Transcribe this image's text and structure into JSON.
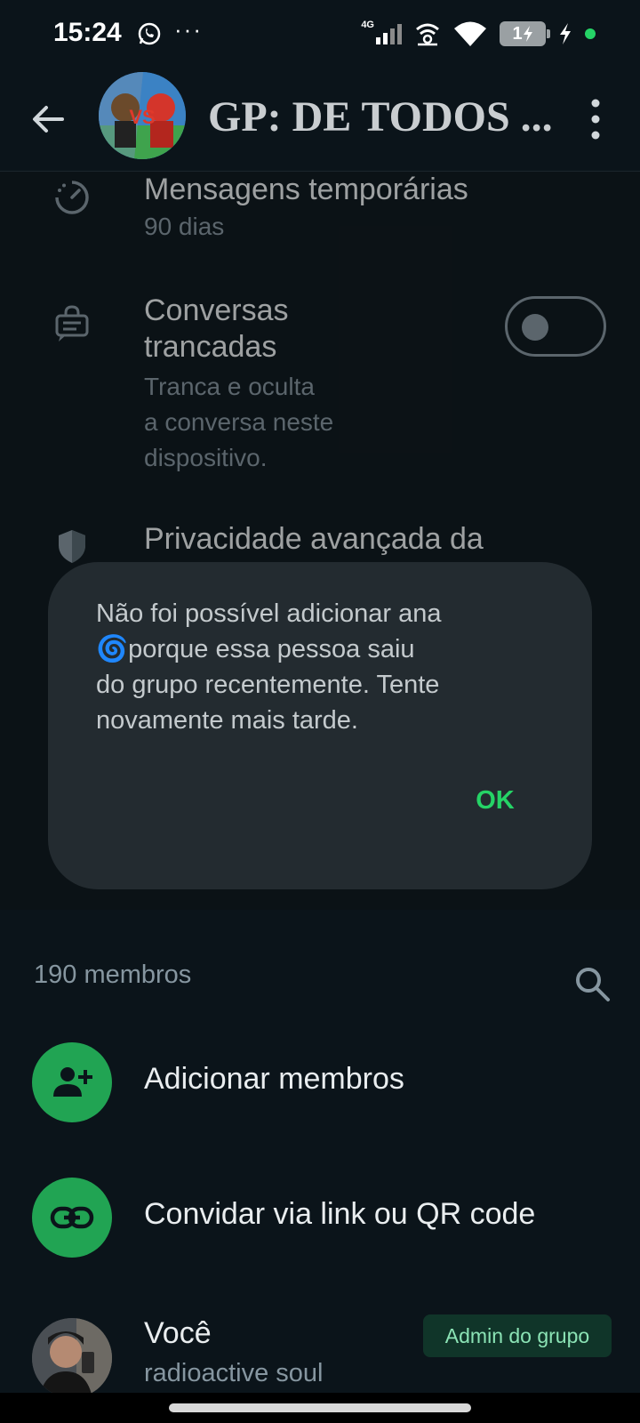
{
  "status_bar": {
    "time": "15:24",
    "more": "···",
    "network": "4G",
    "battery_level": "1"
  },
  "header": {
    "title": "GP: DE TODOS ...",
    "avatar_badge": "VS"
  },
  "settings": {
    "disappearing": {
      "title": "Mensagens temporárias",
      "subtitle": "90 dias"
    },
    "chat_lock": {
      "title_line1": "Conversas",
      "title_line2": "trancadas",
      "subtitle_line1": "Tranca e oculta",
      "subtitle_line2": "a conversa neste",
      "subtitle_line3": "dispositivo.",
      "enabled": false
    },
    "privacy": {
      "title": "Privacidade avançada da"
    }
  },
  "dialog": {
    "message_line1": "Não foi possível adicionar ana",
    "message_line2": "🌀porque essa pessoa saiu",
    "message_line3": "do grupo recentemente. Tente",
    "message_line4": "novamente mais tarde.",
    "ok_label": "OK"
  },
  "members": {
    "count_label": "190 membros",
    "add_label": "Adicionar membros",
    "invite_label": "Convidar via link ou QR code",
    "me": {
      "name": "Você",
      "status": "radioactive soul",
      "badge": "Admin do grupo"
    }
  },
  "colors": {
    "accent": "#21a453",
    "ok": "#25d366"
  }
}
